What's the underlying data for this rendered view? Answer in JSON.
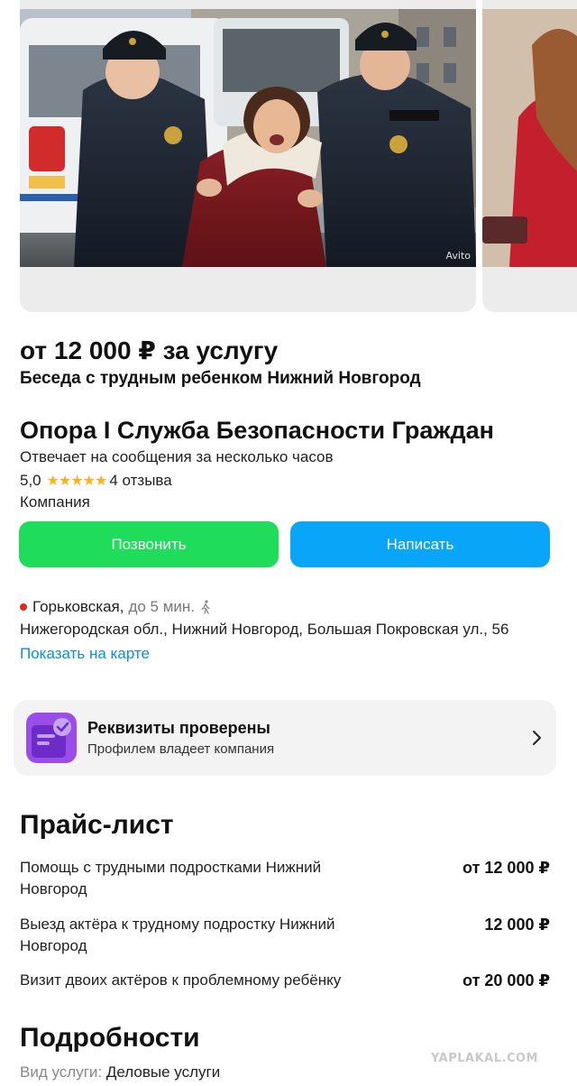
{
  "gallery": {
    "watermark": "Avito"
  },
  "listing": {
    "price_title": "от 12 000 ₽ за услугу",
    "service_title": "Беседа с трудным ребенком Нижний Новгород"
  },
  "seller": {
    "name": "Опора I Служба Безопасности Граждан",
    "reply_time": "Отвечает на сообщения за несколько часов",
    "rating": "5,0",
    "stars": 5,
    "stars_text": "★★★★★",
    "reviews": "4 отзыва",
    "type": "Компания"
  },
  "buttons": {
    "call": "Позвонить",
    "write": "Написать",
    "call_color": "#1fdd5a",
    "write_color": "#09a5f8"
  },
  "location": {
    "metro": "Горьковская,",
    "metro_time": "до 5 мин.",
    "walk_icon": "walking-person-icon",
    "address": "Нижегородская обл., Нижний Новгород, Большая Покровская ул., 56",
    "map_link": "Показать на карте"
  },
  "verification": {
    "title": "Реквизиты проверены",
    "subtitle": "Профилем владеет компания",
    "icon": "verified-document-icon"
  },
  "pricelist": {
    "title": "Прайс-лист",
    "items": [
      {
        "name": "Помощь с трудными подростками Нижний Новгород",
        "price": "от 12 000 ₽"
      },
      {
        "name": "Выезд актёра к трудному подростку Нижний Новгород",
        "price": "12 000 ₽"
      },
      {
        "name": "Визит двоих актёров к проблемному ребёнку",
        "price": "от 20 000 ₽"
      }
    ]
  },
  "details": {
    "title": "Подробности",
    "kind_label": "Вид услуги:",
    "kind_value": "Деловые услуги"
  },
  "site_watermark": "YAPLAKAL.COM"
}
